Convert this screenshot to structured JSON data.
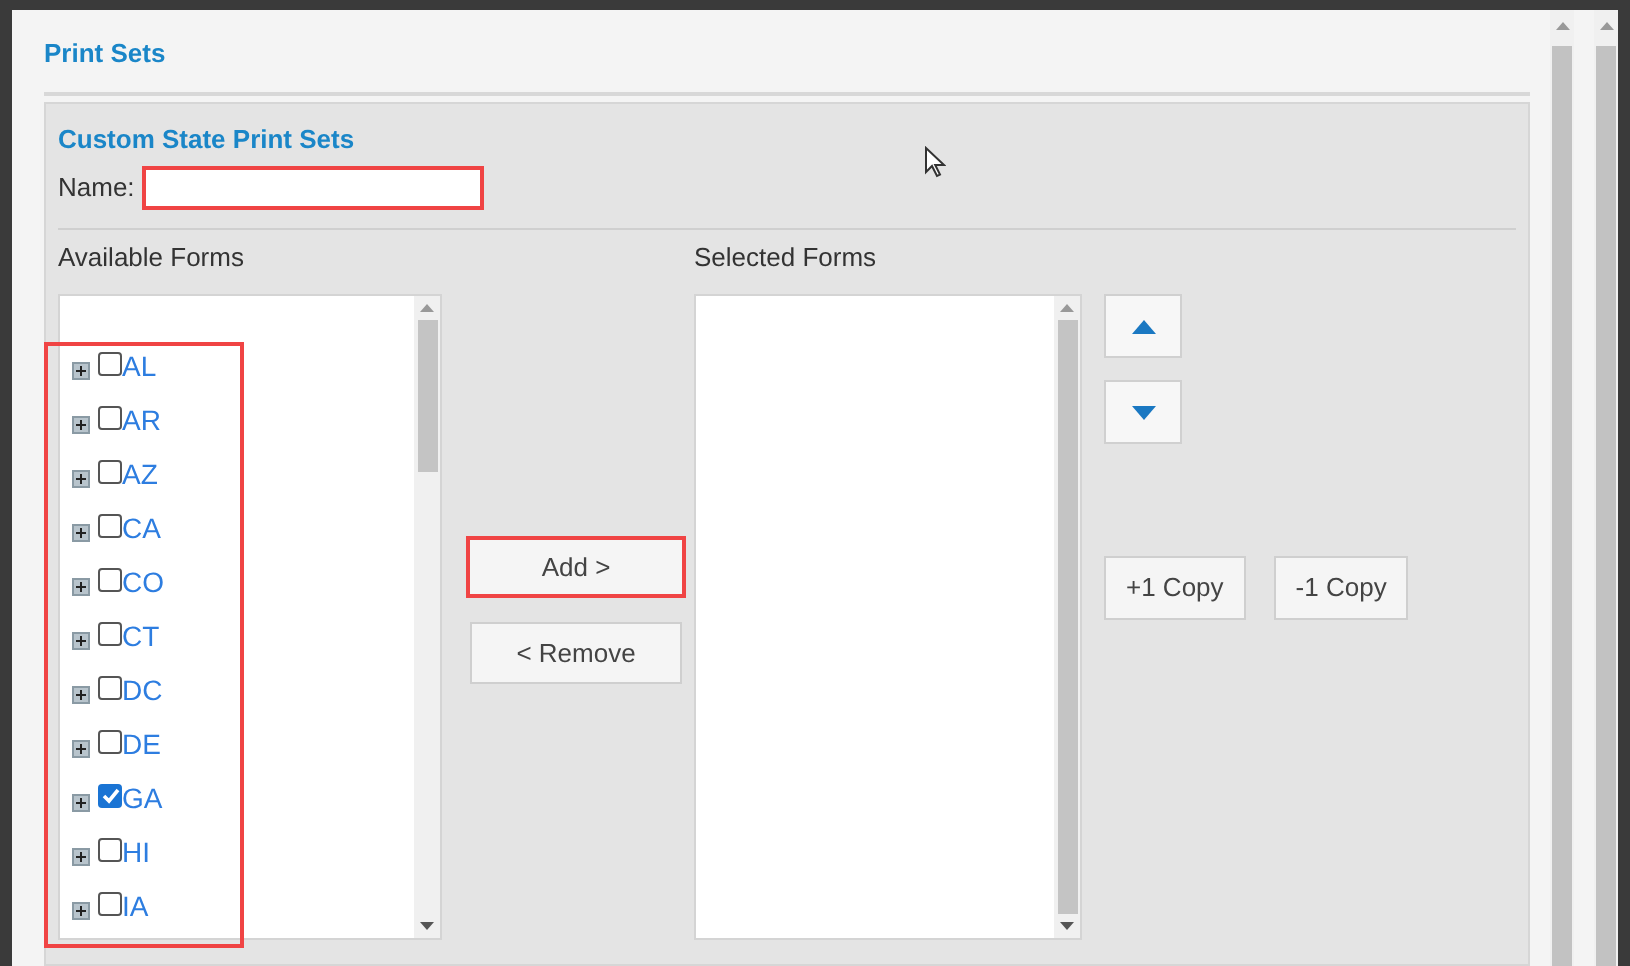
{
  "panel": {
    "title": "Print Sets"
  },
  "section": {
    "title": "Custom State Print Sets",
    "name_label": "Name:",
    "name_highlighted": true
  },
  "available": {
    "label": "Available Forms",
    "highlighted": true,
    "items": [
      {
        "label": "AL",
        "checked": false
      },
      {
        "label": "AR",
        "checked": false
      },
      {
        "label": "AZ",
        "checked": false
      },
      {
        "label": "CA",
        "checked": false
      },
      {
        "label": "CO",
        "checked": false
      },
      {
        "label": "CT",
        "checked": false
      },
      {
        "label": "DC",
        "checked": false
      },
      {
        "label": "DE",
        "checked": false
      },
      {
        "label": "GA",
        "checked": true
      },
      {
        "label": "HI",
        "checked": false
      },
      {
        "label": "IA",
        "checked": false
      }
    ]
  },
  "selected": {
    "label": "Selected Forms"
  },
  "buttons": [
    {
      "label": "Add >",
      "highlighted": true
    },
    {
      "label": "< Remove",
      "highlighted": false
    }
  ],
  "copy_buttons": [
    "+1 Copy",
    "-1 Copy"
  ]
}
